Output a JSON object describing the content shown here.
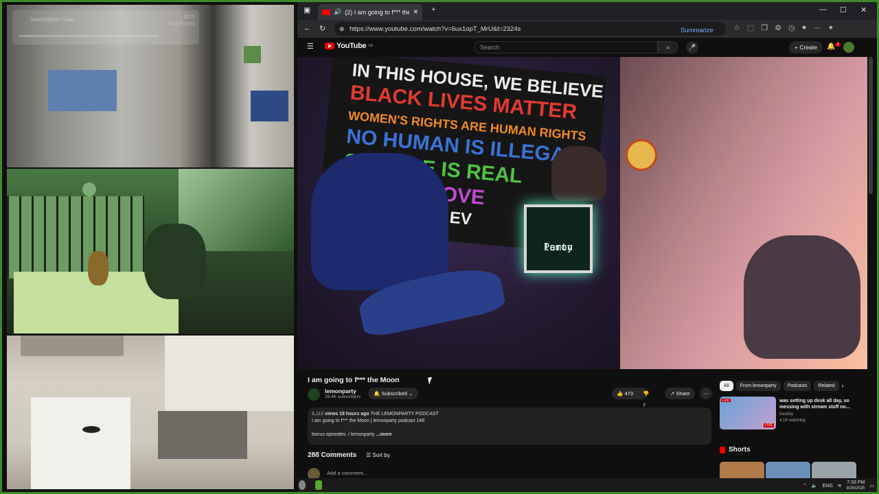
{
  "browser": {
    "tab_title": "(2) I am going to f*** the Moon",
    "url": "https://www.youtube.com/watch?v=6ux1opT_MrU&t=2324s",
    "summarize_label": "Summarize"
  },
  "overlay": {
    "subscription_goal": "Subscription Goal",
    "sub_points_value": "8/10",
    "sub_points_label": "Sub Points"
  },
  "youtube": {
    "logo_text": "YouTube",
    "logo_region": "CA",
    "search_placeholder": "Search",
    "create_label": "Create",
    "notification_count": "2"
  },
  "video": {
    "flag_lines": [
      "IN THIS HOUSE, WE BELIEVE",
      "BLACK LIVES MATTER",
      "WOMEN'S RIGHTS ARE HUMAN RIGHTS",
      "NO HUMAN IS ILLEGAL",
      "SCIENCE IS REAL",
      "LOVE IS LOVE",
      "KINDNESS IS EV"
    ],
    "sign_text_1": "lemon",
    "sign_text_2": "Party",
    "title": "I am going to f*** the Moon",
    "channel": "lemonparty",
    "subscribers": "28.4K subscribers",
    "subscribed_label": "Subscribed",
    "likes": "473",
    "dislikes": "7",
    "share_label": "Share"
  },
  "description": {
    "meta": "views 18 hours ago",
    "views_prefix": "6,113",
    "podcast_tag": "THE LEMONPARTY PODCAST",
    "line2": "I am going to f*** the Moon | lemonparty podcast 148",
    "bonus_label": "bonus episodes:",
    "bonus_link": "/ lemonparty",
    "more_label": "...more"
  },
  "comments": {
    "count_label": "288 Comments",
    "sort_label": "Sort by",
    "add_placeholder": "Add a comment..."
  },
  "sidebar": {
    "chips": [
      "All",
      "From lemonparty",
      "Podcasts",
      "Related"
    ],
    "rec_title": "was setting up desk all day, so messing with stream stuff no...",
    "rec_channel": "Destiny",
    "rec_watching": "4.1K watching",
    "live_label": "LIVE",
    "shorts_label": "Shorts"
  },
  "taskbar": {
    "lang": "ENG",
    "time": "7:33 PM",
    "date": "8/26/2025"
  }
}
